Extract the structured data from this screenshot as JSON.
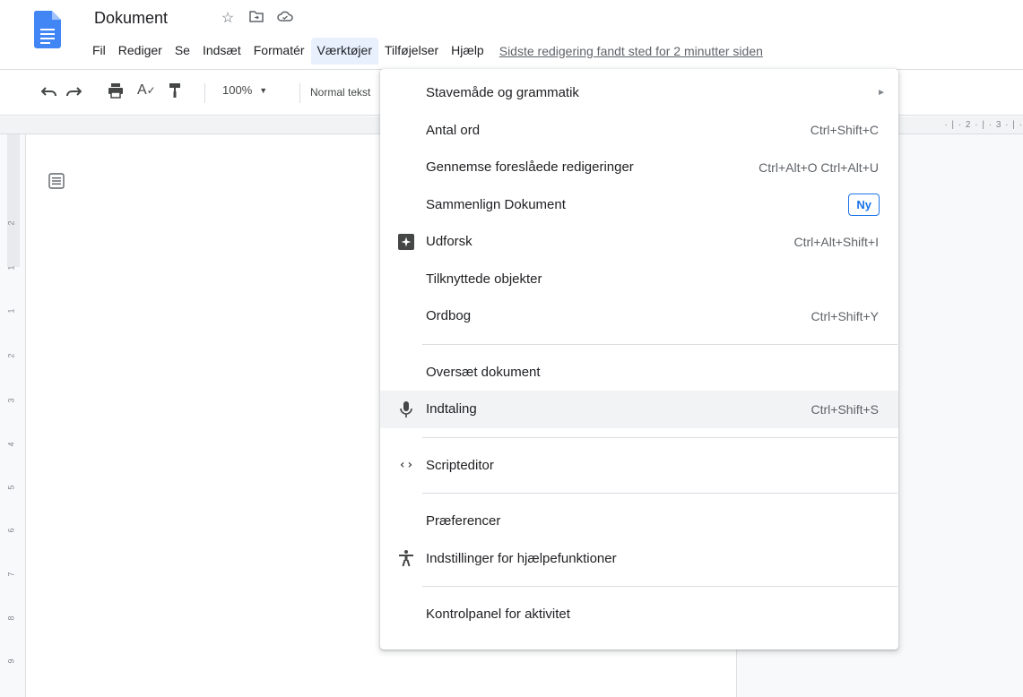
{
  "app": {
    "doc_title": "Dokument",
    "title_icons": [
      "star-icon",
      "move-to-folder-icon",
      "cloud-saved-icon"
    ]
  },
  "menubar": {
    "items": [
      "Fil",
      "Rediger",
      "Se",
      "Indsæt",
      "Formatér",
      "Værktøjer",
      "Tilføjelser",
      "Hjælp"
    ],
    "active": "Værktøjer",
    "last_edit": "Sidste redigering fandt sted for 2 minutter siden"
  },
  "toolbar": {
    "zoom": "100%",
    "style": "Normal tekst",
    "icons": [
      "undo-icon",
      "redo-icon",
      "print-icon",
      "spellcheck-icon",
      "paint-format-icon"
    ]
  },
  "ruler": {
    "top_marks": "· | · 2 · | · 3 · | ·",
    "left_numbers": [
      "2",
      "1",
      "1",
      "2",
      "3",
      "4",
      "5",
      "6",
      "7",
      "8",
      "9"
    ]
  },
  "tools_menu": {
    "items": [
      {
        "label": "Stavemåde og grammatik",
        "shortcut": "",
        "submenu": true
      },
      {
        "label": "Antal ord",
        "shortcut": "Ctrl+Shift+C"
      },
      {
        "label": "Gennemse foreslåede redigeringer",
        "shortcut": "Ctrl+Alt+O Ctrl+Alt+U"
      },
      {
        "label": "Sammenlign Dokument",
        "badge": "Ny"
      },
      {
        "label": "Udforsk",
        "shortcut": "Ctrl+Alt+Shift+I",
        "icon": "explore-icon"
      },
      {
        "label": "Tilknyttede objekter",
        "shortcut": ""
      },
      {
        "label": "Ordbog",
        "shortcut": "Ctrl+Shift+Y"
      },
      {
        "label": "Oversæt dokument",
        "shortcut": ""
      },
      {
        "label": "Indtaling",
        "shortcut": "Ctrl+Shift+S",
        "icon": "microphone-icon",
        "highlighted": true
      },
      {
        "label": "Scripteditor",
        "shortcut": "",
        "icon": "code-icon"
      },
      {
        "label": "Præferencer",
        "shortcut": ""
      },
      {
        "label": "Indstillinger for hjælpefunktioner",
        "shortcut": "",
        "icon": "accessibility-icon"
      },
      {
        "label": "Kontrolpanel for aktivitet",
        "shortcut": ""
      }
    ]
  },
  "colors": {
    "accent": "#1a73e8",
    "doc_blue": "#4285f4",
    "menu_active_bg": "#e8f0fe",
    "hover_bg": "#f1f3f4"
  }
}
